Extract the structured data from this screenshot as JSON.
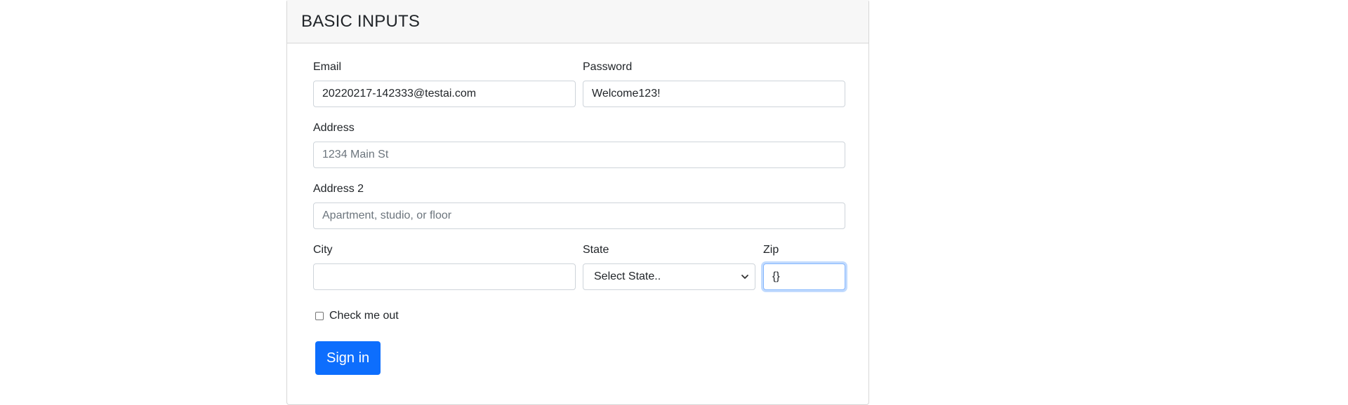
{
  "card": {
    "title": "BASIC INPUTS"
  },
  "form": {
    "email": {
      "label": "Email",
      "value": "20220217-142333@testai.com",
      "placeholder": ""
    },
    "password": {
      "label": "Password",
      "value": "Welcome123!",
      "placeholder": ""
    },
    "address": {
      "label": "Address",
      "value": "",
      "placeholder": "1234 Main St"
    },
    "address2": {
      "label": "Address 2",
      "value": "",
      "placeholder": "Apartment, studio, or floor"
    },
    "city": {
      "label": "City",
      "value": "",
      "placeholder": ""
    },
    "state": {
      "label": "State",
      "selected": "Select State.."
    },
    "zip": {
      "label": "Zip",
      "value": "{}",
      "placeholder": ""
    },
    "checkbox": {
      "label": "Check me out",
      "checked": false
    },
    "submit_label": "Sign in"
  },
  "colors": {
    "primary": "#0d6efd",
    "header_bg": "#f7f7f7",
    "border": "#ced4da",
    "focus_border": "#86b7fe"
  },
  "icons": {
    "state_dropdown": "chevron-down-icon"
  }
}
